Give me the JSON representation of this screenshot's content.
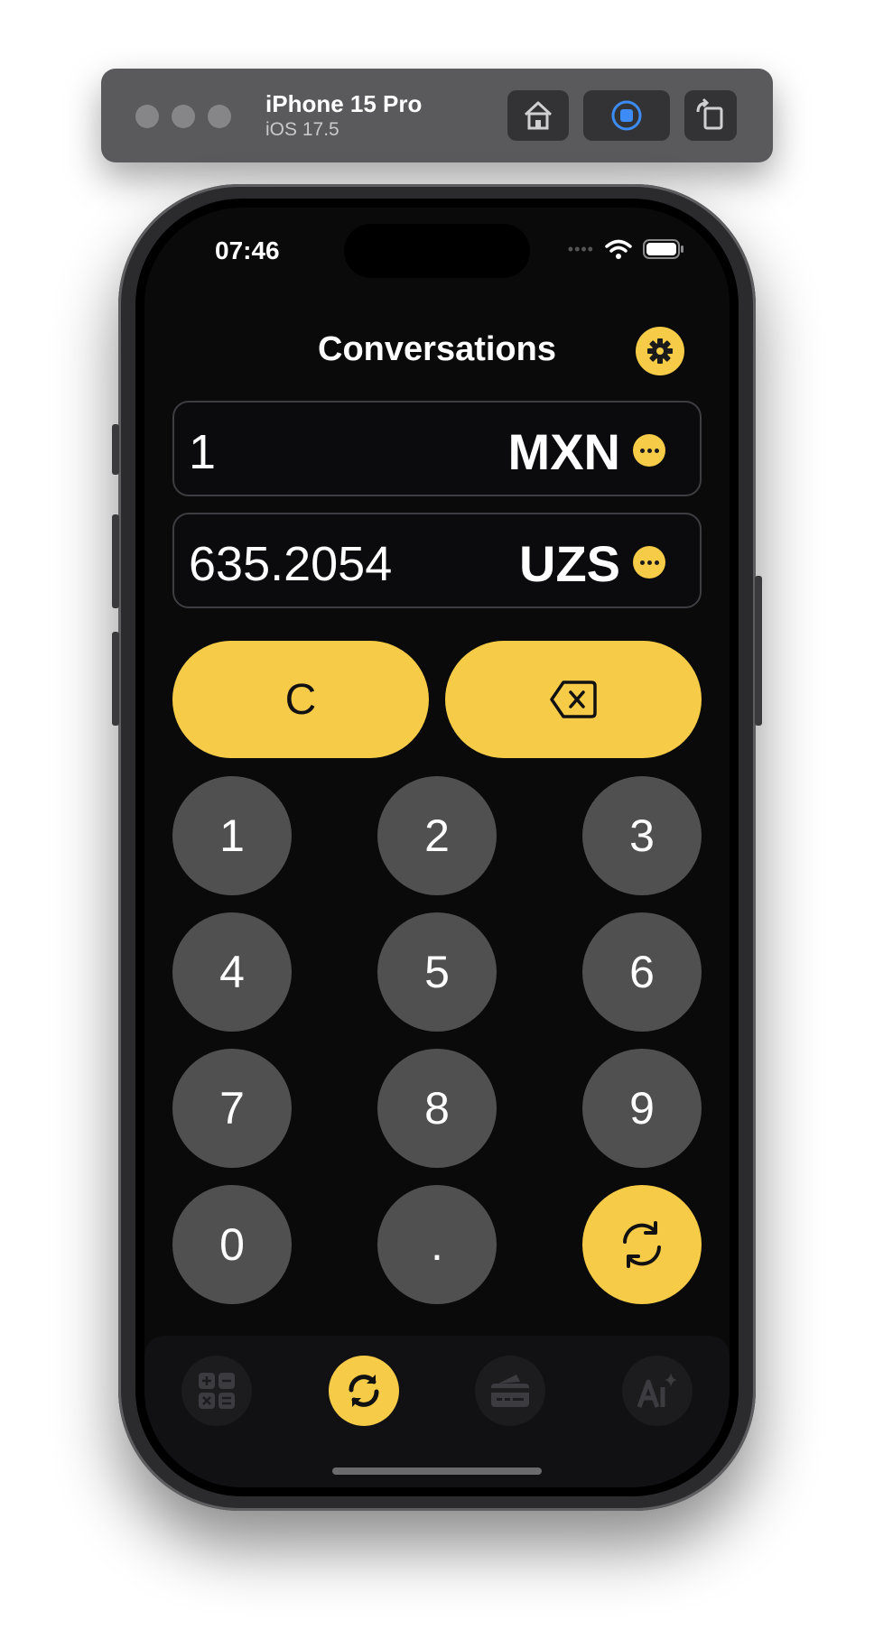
{
  "simulator": {
    "device_name": "iPhone 15 Pro",
    "os_version": "iOS 17.5",
    "icons": [
      "home-icon",
      "screenshot-record-icon",
      "rotate-icon"
    ]
  },
  "status_bar": {
    "time": "07:46"
  },
  "header": {
    "title": "Conversations",
    "settings_icon": "gear-icon"
  },
  "converter": {
    "from": {
      "amount": "1",
      "currency": "MXN"
    },
    "to": {
      "amount": "635.2054",
      "currency": "UZS"
    }
  },
  "actions": {
    "clear_label": "C",
    "backspace_icon": "backspace-icon"
  },
  "keypad": {
    "keys": [
      "1",
      "2",
      "3",
      "4",
      "5",
      "6",
      "7",
      "8",
      "9",
      "0",
      "."
    ],
    "swap_icon": "swap-arrows-icon"
  },
  "tabs": [
    {
      "icon": "calculator-icon",
      "active": false
    },
    {
      "icon": "convert-icon",
      "active": true
    },
    {
      "icon": "card-icon",
      "active": false
    },
    {
      "icon": "ai-sparkle-icon",
      "active": false
    }
  ],
  "colors": {
    "accent": "#f6cb47",
    "key": "#505050",
    "background": "#0a0a0a"
  }
}
